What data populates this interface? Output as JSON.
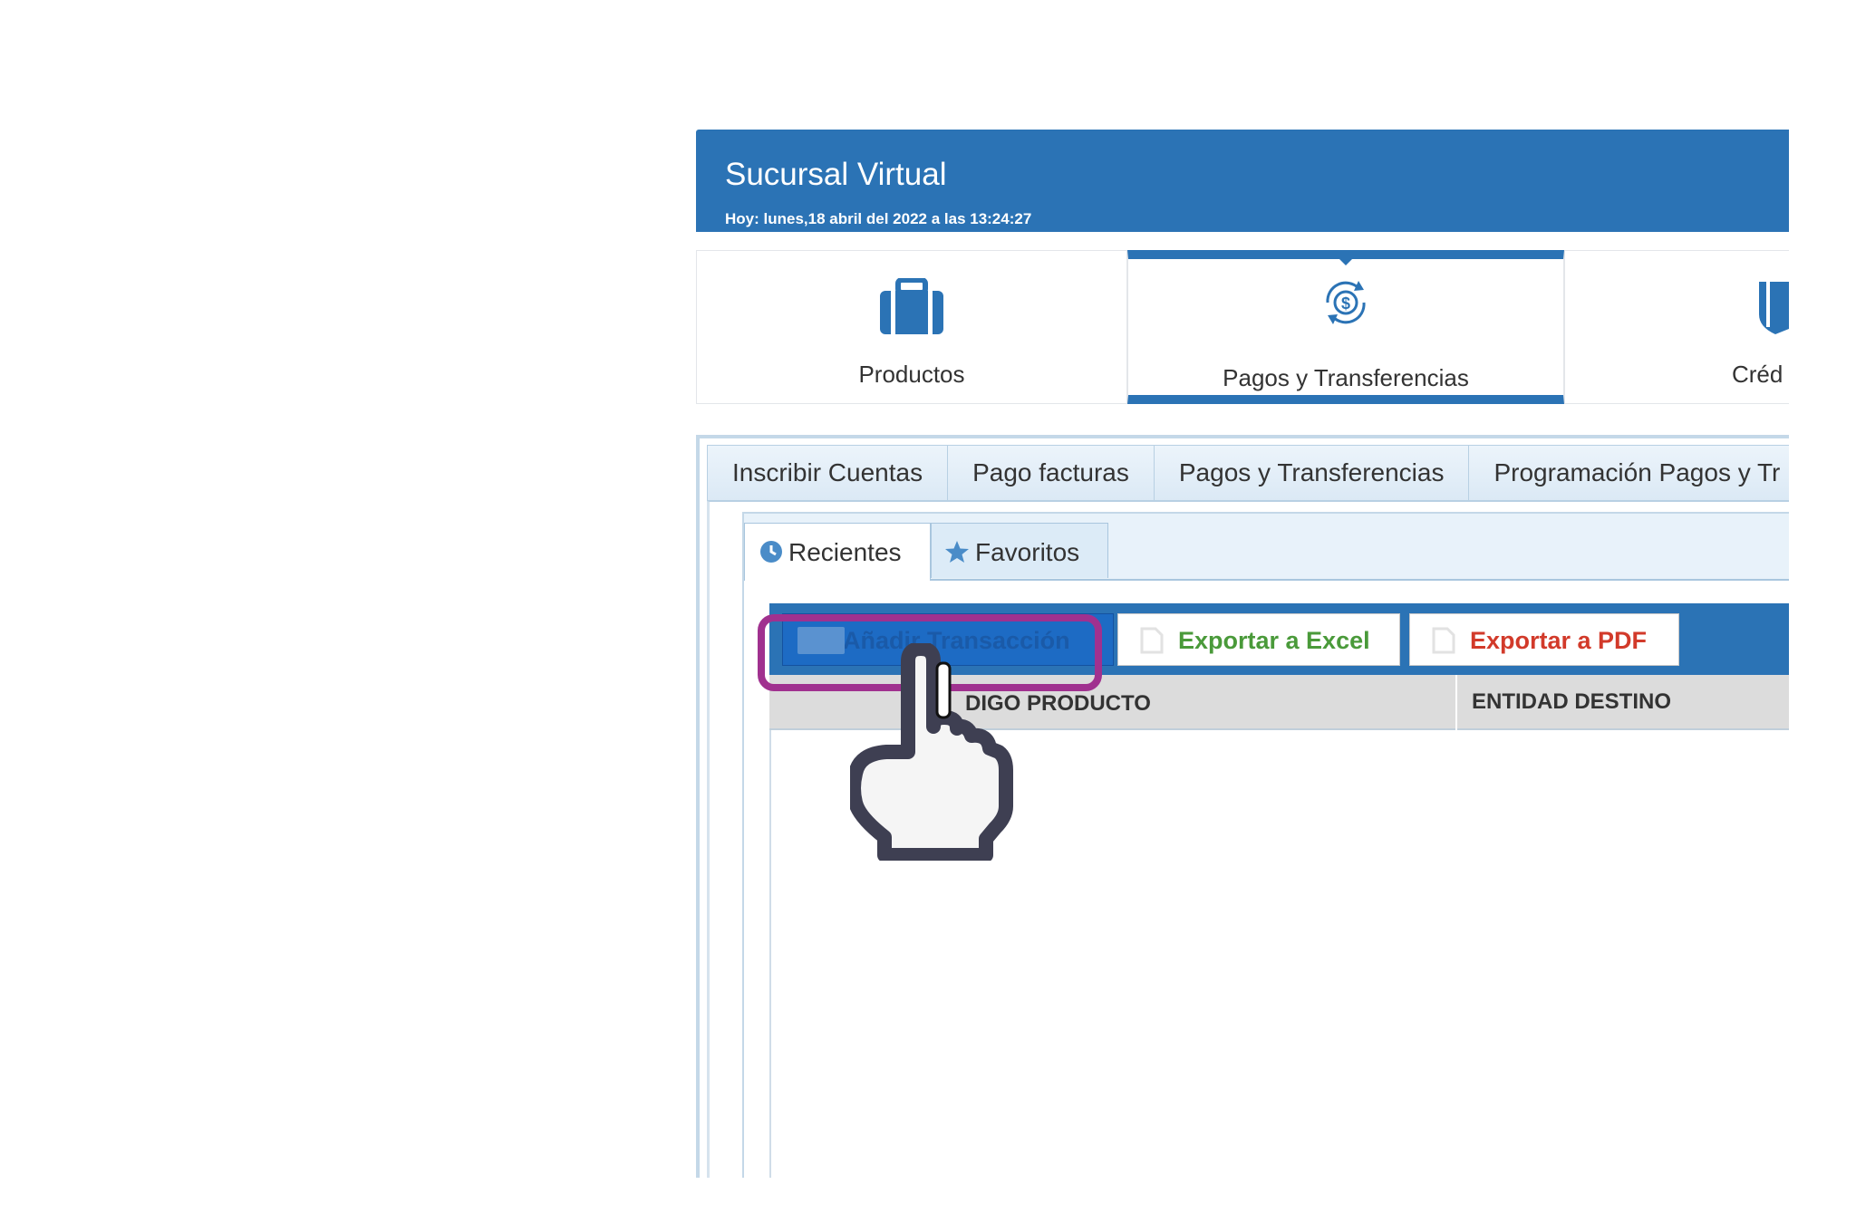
{
  "header": {
    "title": "Sucursal Virtual",
    "date": "Hoy: lunes,18 abril del 2022 a las 13:24:27"
  },
  "main_nav": {
    "items": [
      {
        "label": "Productos",
        "icon": "briefcase-icon"
      },
      {
        "label": "Pagos y Transferencias",
        "icon": "dollar-exchange-icon",
        "active": true
      },
      {
        "label": "Créd",
        "icon": "shield-icon"
      }
    ]
  },
  "subtabs": [
    {
      "label": "Inscribir Cuentas"
    },
    {
      "label": "Pago facturas"
    },
    {
      "label": "Pagos y Transferencias"
    },
    {
      "label": "Programación Pagos y Tr"
    }
  ],
  "inner_tabs": [
    {
      "label": "Recientes",
      "icon": "clock-icon",
      "active": true
    },
    {
      "label": "Favoritos",
      "icon": "star-icon"
    }
  ],
  "toolbar": {
    "add_label": "Añadir Transacción",
    "excel_label": "Exportar a Excel",
    "pdf_label": "Exportar a PDF"
  },
  "grid": {
    "columns": [
      "CÓDIGO PRODUCTO",
      "ENTIDAD DESTINO"
    ],
    "visible_columns": [
      "DIGO PRODUCTO",
      "ENTIDAD DESTINO"
    ]
  },
  "colors": {
    "primary": "#2b73b5",
    "highlight": "#a0318f",
    "excel": "#4a9a3a",
    "pdf": "#d23a2a"
  }
}
